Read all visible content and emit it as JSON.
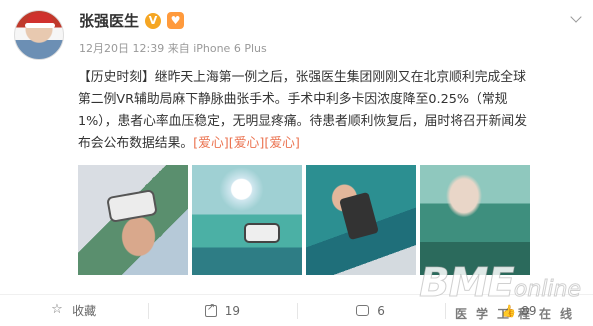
{
  "post": {
    "author": "张强医生",
    "verified_badge": "V",
    "timestamp": "12月20日 12:39",
    "source": "来自 iPhone 6 Plus",
    "content_line1": "【历史时刻】继昨天上海第一例之后，张强医生集团刚刚又在北京顺利完成全球",
    "content_line2": "第二例VR辅助局麻下静脉曲张手术。手术中利多卡因浓度降至0.25%（常规",
    "content_line3": "1%），患者心率血压稳定，无明显疼痛。待患者顺利恢复后，届时将召开新闻发",
    "content_line4": "布会公布数据结果。",
    "emojis": "[爱心][爱心][爱心]"
  },
  "actions": {
    "favorite_label": "收藏",
    "share_count": "19",
    "comment_count": "6",
    "like_count": "89"
  },
  "watermark": {
    "brand": "BME",
    "brand_suffix": "online",
    "tagline": "医学工程在线"
  },
  "icons": [
    "avatar",
    "verified-badge-icon",
    "heart-badge-icon",
    "chevron-down-icon",
    "star-icon",
    "share-icon",
    "comment-icon",
    "like-icon"
  ]
}
